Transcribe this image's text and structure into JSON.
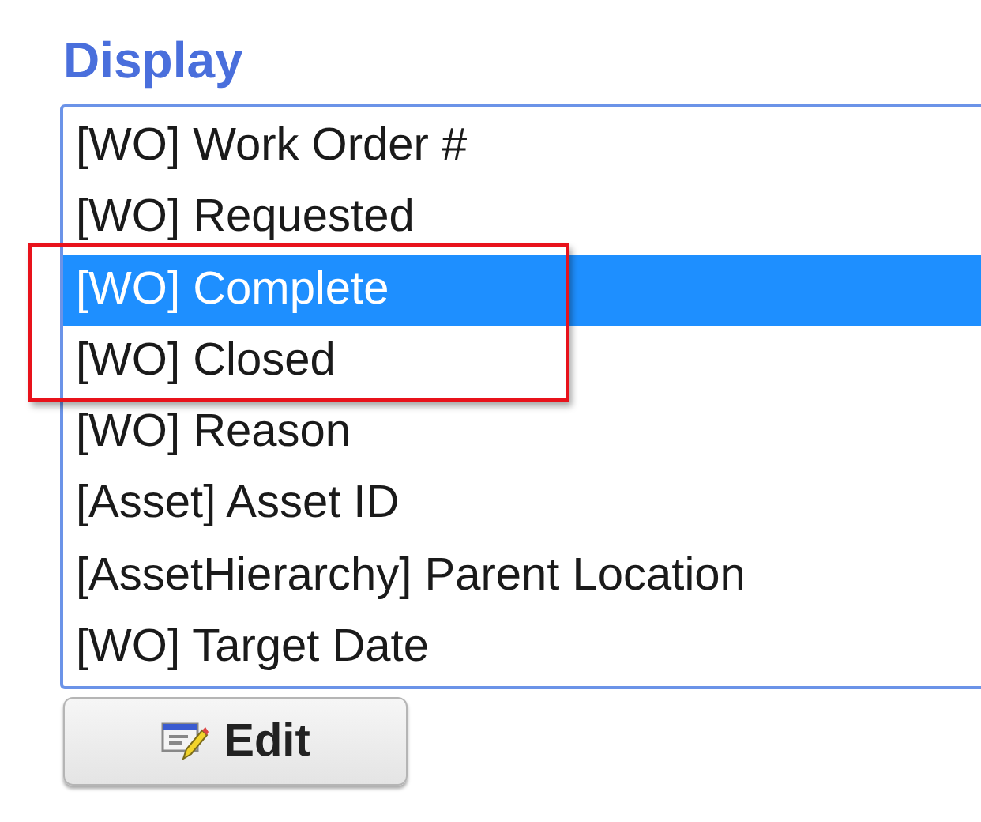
{
  "heading": "Display",
  "items": [
    {
      "label": "[WO] Work Order #",
      "selected": false,
      "highlighted": false
    },
    {
      "label": "[WO] Requested",
      "selected": false,
      "highlighted": false
    },
    {
      "label": "[WO] Complete",
      "selected": true,
      "highlighted": true
    },
    {
      "label": "[WO] Closed",
      "selected": false,
      "highlighted": true
    },
    {
      "label": "[WO] Reason",
      "selected": false,
      "highlighted": false
    },
    {
      "label": "[Asset] Asset ID",
      "selected": false,
      "highlighted": false
    },
    {
      "label": "[AssetHierarchy] Parent Location",
      "selected": false,
      "highlighted": false
    },
    {
      "label": "[WO] Target Date",
      "selected": false,
      "highlighted": false
    }
  ],
  "button": {
    "label": "Edit"
  }
}
